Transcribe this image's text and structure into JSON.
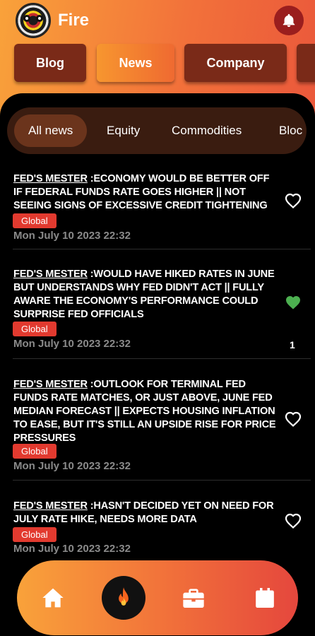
{
  "app": {
    "title": "Fire"
  },
  "tabs": [
    {
      "label": "Blog"
    },
    {
      "label": "News"
    },
    {
      "label": "Company"
    }
  ],
  "chips": [
    {
      "label": "All news"
    },
    {
      "label": "Equity"
    },
    {
      "label": "Commodities"
    },
    {
      "label": "Bloc"
    }
  ],
  "news": [
    {
      "source": "FED'S MESTER",
      "text": " :ECONOMY WOULD BE BETTER OFF IF FEDERAL FUNDS RATE GOES HIGHER || NOT SEEING SIGNS OF EXCESSIVE CREDIT TIGHTENING",
      "tag": "Global",
      "date": "Mon July 10 2023 22:32",
      "liked": false,
      "likes": ""
    },
    {
      "source": "FED'S MESTER",
      "text": " :WOULD HAVE HIKED RATES IN JUNE BUT UNDERSTANDS WHY FED DIDN'T ACT || FULLY AWARE THE ECONOMY'S PERFORMANCE COULD SURPRISE FED OFFICIALS",
      "tag": "Global",
      "date": "Mon July 10 2023 22:32",
      "liked": true,
      "likes": "1"
    },
    {
      "source": "FED'S MESTER",
      "text": " :OUTLOOK FOR TERMINAL FED FUNDS RATE MATCHES, OR JUST ABOVE, JUNE FED MEDIAN FORECAST || EXPECTS HOUSING INFLATION TO EASE, BUT IT'S STILL AN UPSIDE RISE FOR PRICE PRESSURES",
      "tag": "Global",
      "date": "Mon July 10 2023 22:32",
      "liked": false,
      "likes": ""
    },
    {
      "source": "FED'S MESTER",
      "text": " :HASN'T DECIDED YET ON NEED FOR JULY RATE HIKE, NEEDS MORE DATA",
      "tag": "Global",
      "date": "Mon July 10 2023 22:32",
      "liked": false,
      "likes": ""
    }
  ],
  "colors": {
    "accent_orange": "#f9a23a",
    "accent_red": "#e5483c",
    "badge": "#e23a2f",
    "liked": "#4caf50"
  },
  "icons": {
    "notifications": "bell-icon",
    "nav": [
      "home-icon",
      "flame-icon",
      "briefcase-icon",
      "calendar-icon"
    ]
  }
}
